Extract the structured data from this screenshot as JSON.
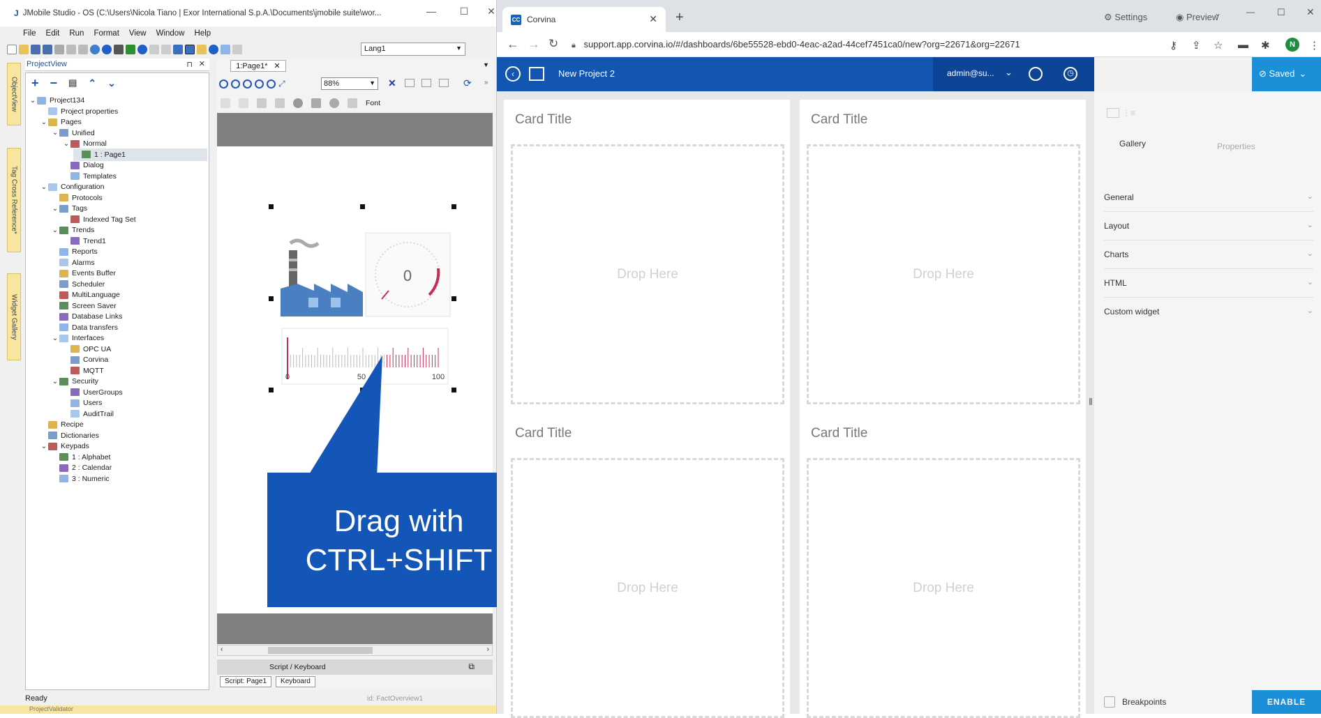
{
  "jmobile": {
    "title": "JMobile Studio - OS (C:\\Users\\Nicola Tiano | Exor International S.p.A.\\Documents\\jmobile suite\\wor...",
    "menu": [
      "File",
      "Edit",
      "Run",
      "Format",
      "View",
      "Window",
      "Help"
    ],
    "language_select": "Lang1",
    "side_tabs": [
      "ObjectView",
      "Tag Cross Reference*",
      "Widget Gallery"
    ],
    "projectview_title": "ProjectView",
    "tree": [
      {
        "label": "Project134",
        "depth": 0,
        "arrow": "v"
      },
      {
        "label": "Project properties",
        "depth": 1,
        "arrow": ""
      },
      {
        "label": "Pages",
        "depth": 1,
        "arrow": "v"
      },
      {
        "label": "Unified",
        "depth": 2,
        "arrow": "v"
      },
      {
        "label": "Normal",
        "depth": 3,
        "arrow": "v"
      },
      {
        "label": "1 : Page1",
        "depth": 4,
        "arrow": "",
        "selected": true
      },
      {
        "label": "Dialog",
        "depth": 3,
        "arrow": ""
      },
      {
        "label": "Templates",
        "depth": 3,
        "arrow": ""
      },
      {
        "label": "Configuration",
        "depth": 1,
        "arrow": "v"
      },
      {
        "label": "Protocols",
        "depth": 2,
        "arrow": ""
      },
      {
        "label": "Tags",
        "depth": 2,
        "arrow": "v"
      },
      {
        "label": "Indexed Tag Set",
        "depth": 3,
        "arrow": ""
      },
      {
        "label": "Trends",
        "depth": 2,
        "arrow": "v"
      },
      {
        "label": "Trend1",
        "depth": 3,
        "arrow": ""
      },
      {
        "label": "Reports",
        "depth": 2,
        "arrow": ""
      },
      {
        "label": "Alarms",
        "depth": 2,
        "arrow": ""
      },
      {
        "label": "Events Buffer",
        "depth": 2,
        "arrow": ""
      },
      {
        "label": "Scheduler",
        "depth": 2,
        "arrow": ""
      },
      {
        "label": "MultiLanguage",
        "depth": 2,
        "arrow": ""
      },
      {
        "label": "Screen Saver",
        "depth": 2,
        "arrow": ""
      },
      {
        "label": "Database Links",
        "depth": 2,
        "arrow": ""
      },
      {
        "label": "Data transfers",
        "depth": 2,
        "arrow": ""
      },
      {
        "label": "Interfaces",
        "depth": 2,
        "arrow": "v"
      },
      {
        "label": "OPC UA",
        "depth": 3,
        "arrow": ""
      },
      {
        "label": "Corvina",
        "depth": 3,
        "arrow": ""
      },
      {
        "label": "MQTT",
        "depth": 3,
        "arrow": ""
      },
      {
        "label": "Security",
        "depth": 2,
        "arrow": "v"
      },
      {
        "label": "UserGroups",
        "depth": 3,
        "arrow": ""
      },
      {
        "label": "Users",
        "depth": 3,
        "arrow": ""
      },
      {
        "label": "AuditTrail",
        "depth": 3,
        "arrow": ""
      },
      {
        "label": "Recipe",
        "depth": 1,
        "arrow": ""
      },
      {
        "label": "Dictionaries",
        "depth": 1,
        "arrow": ""
      },
      {
        "label": "Keypads",
        "depth": 1,
        "arrow": "v"
      },
      {
        "label": "1 : Alphabet",
        "depth": 2,
        "arrow": ""
      },
      {
        "label": "2 : Calendar",
        "depth": 2,
        "arrow": ""
      },
      {
        "label": "3 : Numeric",
        "depth": 2,
        "arrow": ""
      }
    ],
    "doc_tab": "1:Page1*",
    "zoom": "88%",
    "font_label": "Font",
    "gauge_value": "0",
    "scale_labels": [
      "0",
      "50",
      "100"
    ],
    "script_bar": "Script / Keyboard",
    "script_tabs": [
      "Script: Page1",
      "Keyboard"
    ],
    "status": "Ready",
    "status_id": "id: FactOverview1",
    "status_bottom": "ProjectValidator"
  },
  "callout": {
    "line1": "Drag with",
    "line2": "CTRL+SHIFT"
  },
  "browser": {
    "tab_title": "Corvina",
    "favicon": "CC",
    "url": "support.app.corvina.io/#/dashboards/6be55528-ebd0-4eac-a2ad-44cef7451ca0/new?org=22671&org=22671",
    "avatar": "N"
  },
  "corvina": {
    "project_name": "New Project 2",
    "user": "admin@su...",
    "settings": "Settings",
    "preview": "Preview",
    "saved": "Saved",
    "cards": [
      {
        "title": "Card Title",
        "drop": "Drop Here"
      },
      {
        "title": "Card Title",
        "drop": "Drop Here"
      },
      {
        "title": "Card Title",
        "drop": "Drop Here"
      },
      {
        "title": "Card Title",
        "drop": "Drop Here"
      }
    ],
    "tabs": [
      "Gallery",
      "Properties"
    ],
    "accordion": [
      "General",
      "Layout",
      "Charts",
      "HTML",
      "Custom widget"
    ],
    "breakpoints": "Breakpoints",
    "enable": "ENABLE"
  }
}
